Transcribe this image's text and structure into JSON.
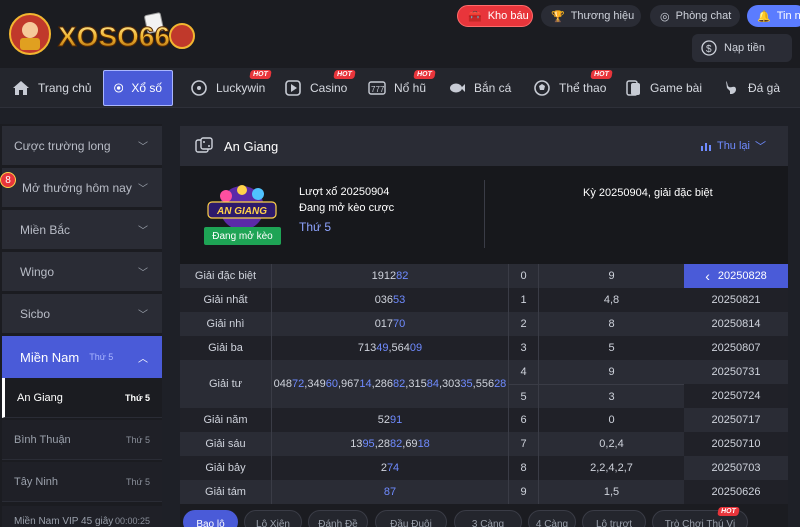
{
  "header": {
    "logo_text": "XOSO66",
    "kho_bau": "Kho báu",
    "thuong_hieu": "Thương hiệu",
    "phong_chat": "Phòng chat",
    "tin_nhan": "Tin n",
    "nap_tien": "Nạp tiền"
  },
  "nav": {
    "items": [
      {
        "label": "Trang chủ"
      },
      {
        "label": "Xổ số"
      },
      {
        "label": "Luckywin",
        "badge": "HOT"
      },
      {
        "label": "Casino",
        "badge": "HOT"
      },
      {
        "label": "Nổ hũ",
        "badge": "HOT"
      },
      {
        "label": "Bắn cá"
      },
      {
        "label": "Thể thao",
        "badge": "HOT"
      },
      {
        "label": "Game bài"
      },
      {
        "label": "Đá gà"
      }
    ]
  },
  "sidebar": {
    "badge": "8",
    "items": [
      {
        "label": "Cược trường long"
      },
      {
        "label": "Mở thưởng hôm nay"
      },
      {
        "label": "Miền Bắc"
      },
      {
        "label": "Wingo"
      },
      {
        "label": "Sicbo"
      },
      {
        "label": "Miền Nam",
        "sub": "Thứ 5"
      }
    ],
    "sub_items": [
      {
        "label": "An Giang",
        "day": "Thứ 5"
      },
      {
        "label": "Bình Thuận",
        "day": "Thứ 5"
      },
      {
        "label": "Tây Ninh",
        "day": "Thứ 5"
      },
      {
        "label": "Miền Nam VIP 45 giây",
        "day": "00:00:25"
      }
    ]
  },
  "main": {
    "title": "An Giang",
    "thu_lai": "Thu lại",
    "badge": "Đang mở kèo",
    "logo_text": "AN GIANG",
    "luot_xo": "Lượt xổ 20250904",
    "status": "Đang mở kèo cược",
    "day": "Thứ 5",
    "ky": "Kỳ 20250904, giải đặc biệt"
  },
  "results": [
    {
      "prize": "Giải đặc biệt",
      "parts": [
        [
          "1912",
          "82"
        ]
      ],
      "idx": "0",
      "tail": "9"
    },
    {
      "prize": "Giải nhất",
      "parts": [
        [
          "036",
          "53"
        ]
      ],
      "idx": "1",
      "tail": "4,8"
    },
    {
      "prize": "Giải nhì",
      "parts": [
        [
          "017",
          "70"
        ]
      ],
      "idx": "2",
      "tail": "8"
    },
    {
      "prize": "Giải ba",
      "parts": [
        [
          "713",
          "49"
        ],
        [
          "564",
          "09"
        ]
      ],
      "idx": "3",
      "tail": "5"
    },
    {
      "prize": "Giải tư",
      "parts": [
        [
          "048",
          "72"
        ],
        [
          "349",
          "60"
        ],
        [
          "967",
          "14"
        ],
        [
          "286",
          "82"
        ],
        [
          "315",
          "84"
        ],
        [
          "303",
          "35"
        ],
        [
          "556",
          "28"
        ]
      ],
      "idx": "4",
      "tail": "9",
      "idx2": "5",
      "tail2": "3"
    },
    {
      "prize": "Giải năm",
      "parts": [
        [
          "52",
          "91"
        ]
      ],
      "idx": "6",
      "tail": "0"
    },
    {
      "prize": "Giải sáu",
      "parts": [
        [
          "13",
          "95"
        ],
        [
          "28",
          "82"
        ],
        [
          "69",
          "18"
        ]
      ],
      "idx": "7",
      "tail": "0,2,4"
    },
    {
      "prize": "Giải bảy",
      "parts": [
        [
          "2",
          "74"
        ]
      ],
      "idx": "8",
      "tail": "2,2,4,2,7"
    },
    {
      "prize": "Giải tám",
      "parts": [
        [
          "",
          "87"
        ]
      ],
      "idx": "9",
      "tail": "1,5"
    }
  ],
  "dates": [
    "20250828",
    "20250821",
    "20250814",
    "20250807",
    "20250731",
    "20250724",
    "20250717",
    "20250710",
    "20250703",
    "20250626"
  ],
  "tabs": [
    {
      "label": "Bao lô"
    },
    {
      "label": "Lô Xiên"
    },
    {
      "label": "Đánh Đề"
    },
    {
      "label": "Đầu Đuôi"
    },
    {
      "label": "3 Càng"
    },
    {
      "label": "4 Càng"
    },
    {
      "label": "Lô trượt"
    },
    {
      "label": "Trò Chơi Thú Vị",
      "badge": "HOT"
    }
  ]
}
